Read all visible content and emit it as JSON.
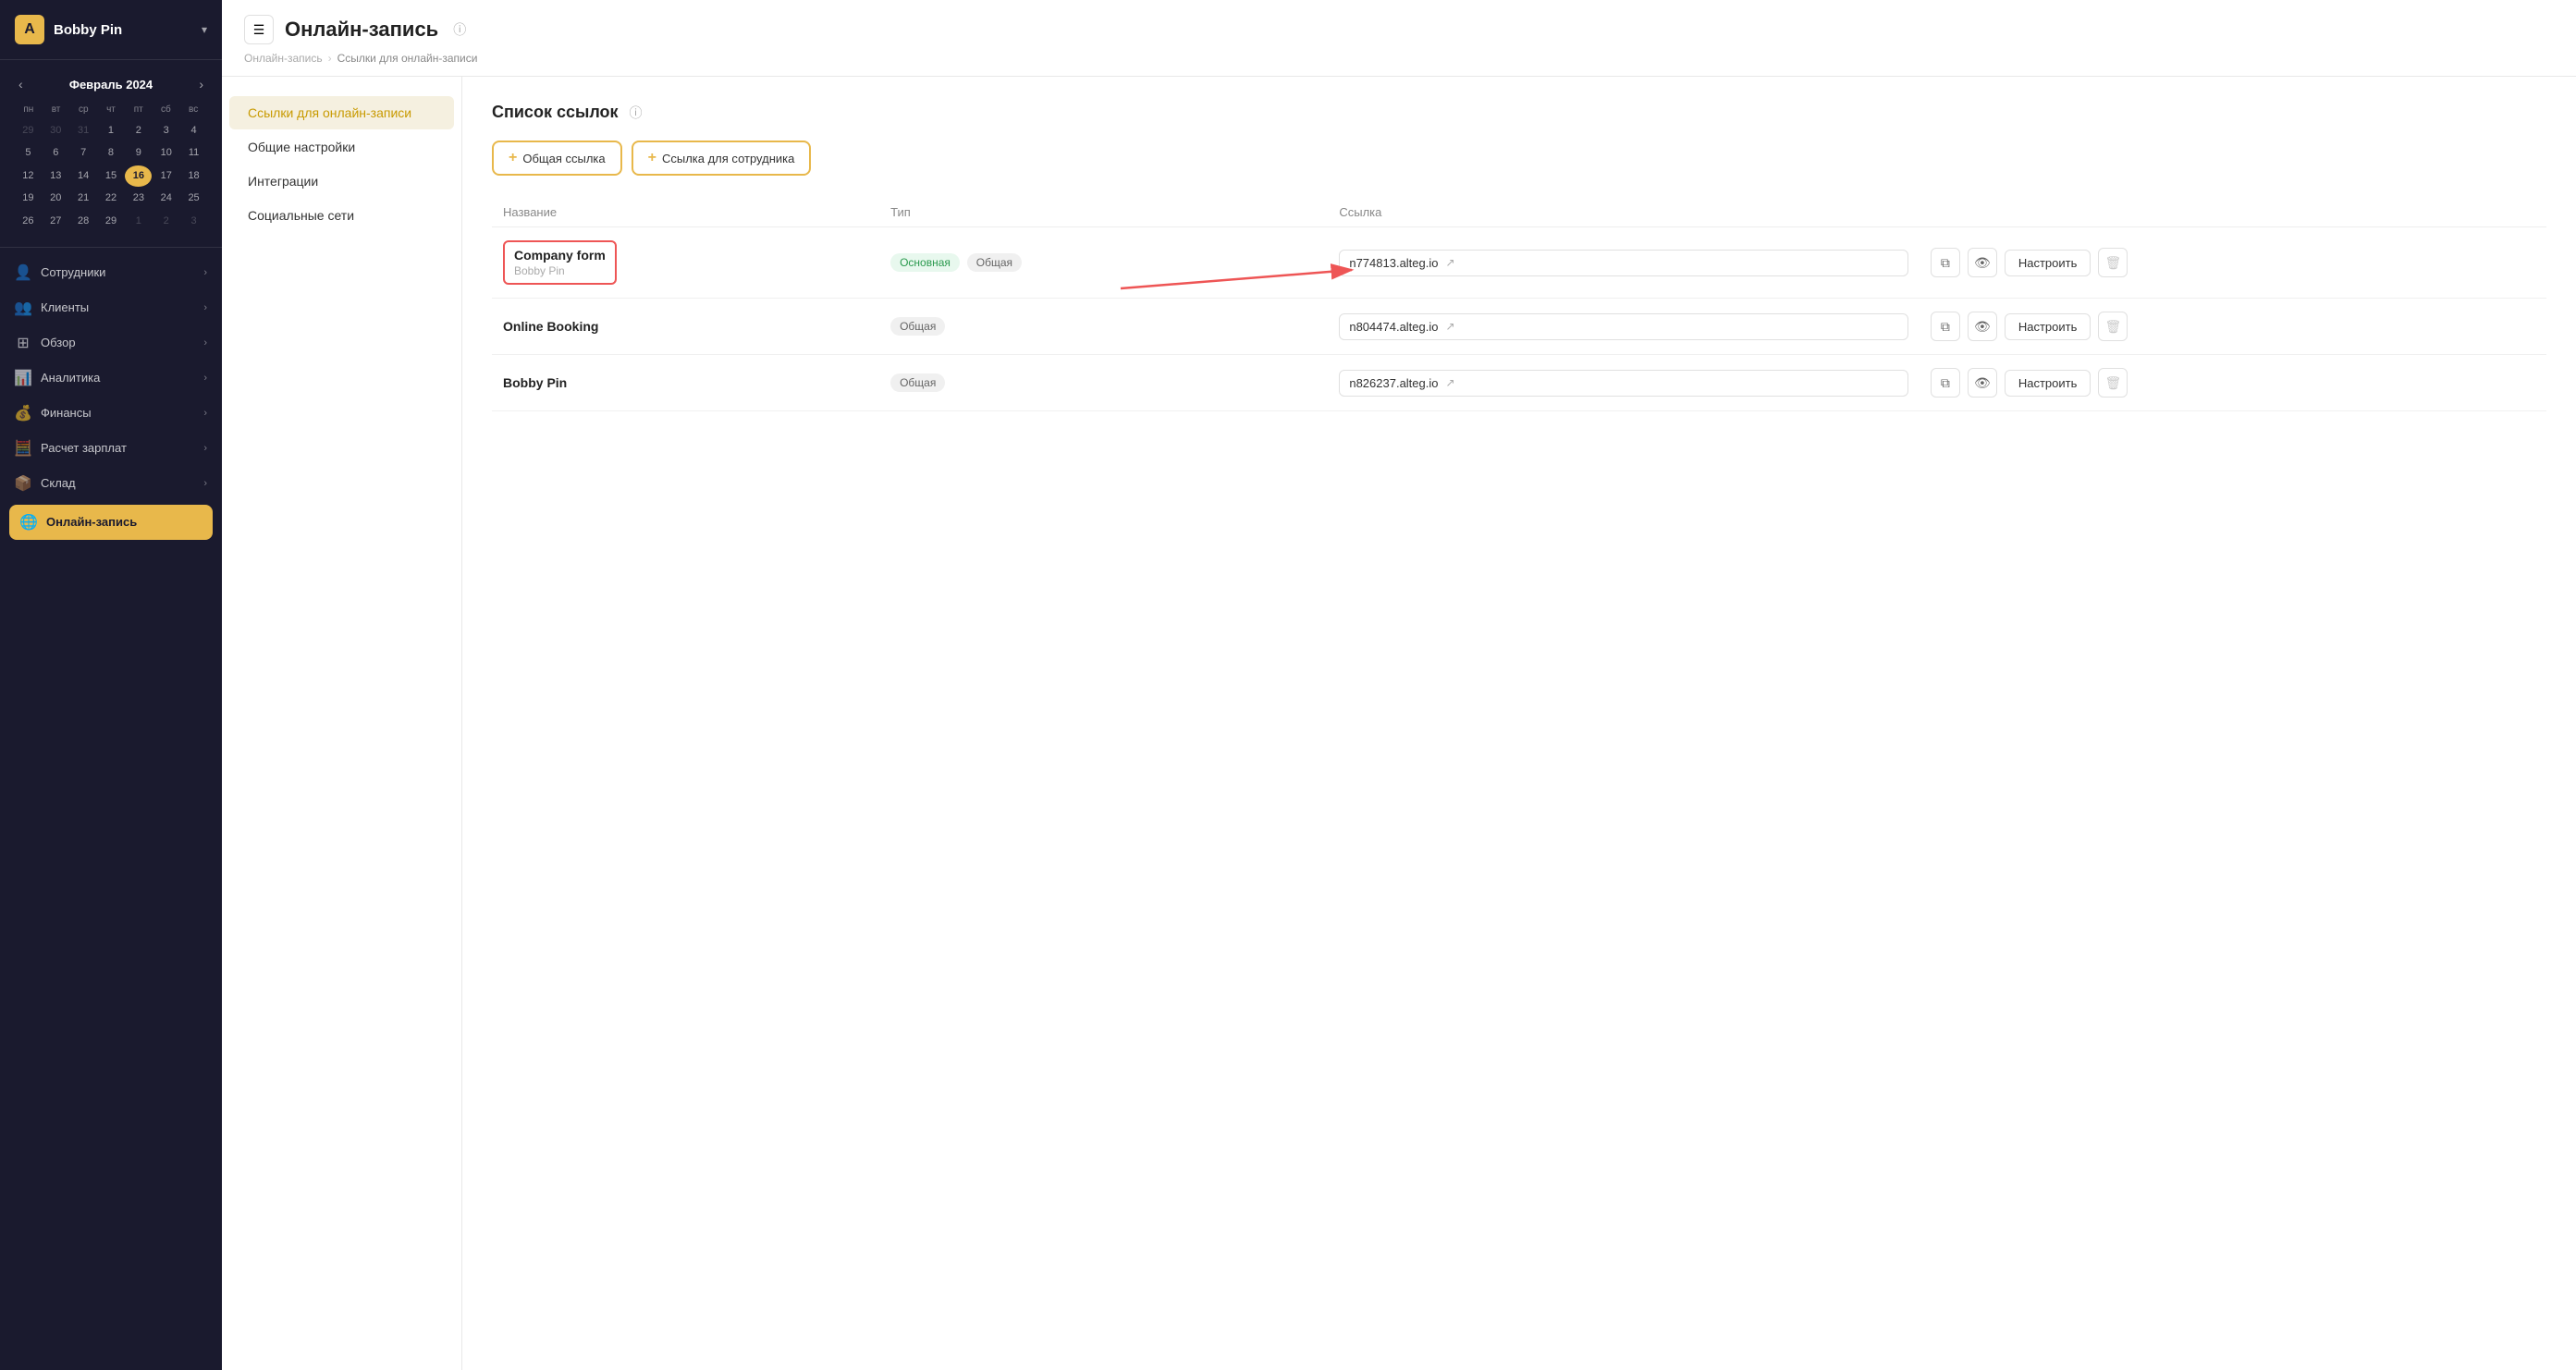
{
  "app": {
    "name": "Bobby Pin",
    "logo_letter": "A"
  },
  "sidebar": {
    "calendar": {
      "title": "Февраль 2024",
      "days_header": [
        "пн",
        "вт",
        "ср",
        "чт",
        "пт",
        "сб",
        "вс"
      ],
      "weeks": [
        [
          {
            "day": "29",
            "other": true
          },
          {
            "day": "30",
            "other": true
          },
          {
            "day": "31",
            "other": true
          },
          {
            "day": "1"
          },
          {
            "day": "2"
          },
          {
            "day": "3"
          },
          {
            "day": "4"
          }
        ],
        [
          {
            "day": "5"
          },
          {
            "day": "6"
          },
          {
            "day": "7"
          },
          {
            "day": "8"
          },
          {
            "day": "9"
          },
          {
            "day": "10"
          },
          {
            "day": "11"
          }
        ],
        [
          {
            "day": "12"
          },
          {
            "day": "13"
          },
          {
            "day": "14"
          },
          {
            "day": "15"
          },
          {
            "day": "16",
            "today": true
          },
          {
            "day": "17"
          },
          {
            "day": "18"
          }
        ],
        [
          {
            "day": "19"
          },
          {
            "day": "20"
          },
          {
            "day": "21"
          },
          {
            "day": "22"
          },
          {
            "day": "23"
          },
          {
            "day": "24"
          },
          {
            "day": "25"
          }
        ],
        [
          {
            "day": "26"
          },
          {
            "day": "27"
          },
          {
            "day": "28"
          },
          {
            "day": "29"
          },
          {
            "day": "1",
            "other": true
          },
          {
            "day": "2",
            "other": true
          },
          {
            "day": "3",
            "other": true
          }
        ]
      ]
    },
    "nav_items": [
      {
        "id": "employees",
        "label": "Сотрудники",
        "icon": "👤"
      },
      {
        "id": "clients",
        "label": "Клиенты",
        "icon": "👥"
      },
      {
        "id": "overview",
        "label": "Обзор",
        "icon": "⊞"
      },
      {
        "id": "analytics",
        "label": "Аналитика",
        "icon": "📊"
      },
      {
        "id": "finances",
        "label": "Финансы",
        "icon": "💰"
      },
      {
        "id": "payroll",
        "label": "Расчет зарплат",
        "icon": "🧮"
      },
      {
        "id": "warehouse",
        "label": "Склад",
        "icon": "📦"
      }
    ],
    "online_booking": {
      "label": "Онлайн-запись",
      "icon": "🌐"
    }
  },
  "header": {
    "title": "Онлайн-запись",
    "breadcrumb_home": "Онлайн-запись",
    "breadcrumb_current": "Ссылки для онлайн-записи"
  },
  "side_nav": {
    "items": [
      {
        "id": "links",
        "label": "Ссылки для онлайн-записи",
        "active": true
      },
      {
        "id": "settings",
        "label": "Общие настройки"
      },
      {
        "id": "integrations",
        "label": "Интеграции"
      },
      {
        "id": "social",
        "label": "Социальные сети"
      }
    ]
  },
  "main": {
    "title": "Список ссылок",
    "btn_add_general": "+ Общая ссылка",
    "btn_add_employee": "+ Ссылка для сотрудника",
    "table": {
      "columns": [
        "Название",
        "Тип",
        "Ссылка",
        ""
      ],
      "rows": [
        {
          "id": "row1",
          "name": "Company form",
          "subtitle": "Bobby Pin",
          "badges": [
            {
              "label": "Основная",
              "type": "green"
            },
            {
              "label": "Общая",
              "type": "gray"
            }
          ],
          "link": "n774813.alteg.io",
          "highlighted": true
        },
        {
          "id": "row2",
          "name": "Online Booking",
          "subtitle": "",
          "badges": [
            {
              "label": "Общая",
              "type": "gray"
            }
          ],
          "link": "n804474.alteg.io",
          "highlighted": false
        },
        {
          "id": "row3",
          "name": "Bobby Pin",
          "subtitle": "",
          "badges": [
            {
              "label": "Общая",
              "type": "gray"
            }
          ],
          "link": "n826237.alteg.io",
          "highlighted": false
        }
      ]
    },
    "configure_label": "Настроить"
  }
}
